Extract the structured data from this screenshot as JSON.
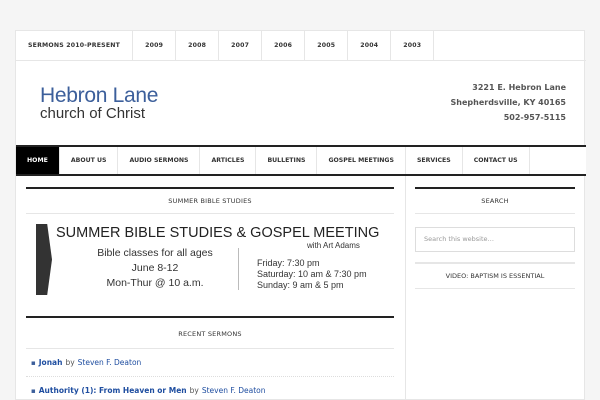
{
  "top_nav": [
    "SERMONS 2010-PRESENT",
    "2009",
    "2008",
    "2007",
    "2006",
    "2005",
    "2004",
    "2003"
  ],
  "logo": {
    "line1": "Hebron Lane",
    "line2": "church of Christ"
  },
  "address": {
    "street": "3221 E. Hebron Lane",
    "city": "Shepherdsville, KY 40165",
    "phone": "502-957-5115"
  },
  "main_nav": [
    "HOME",
    "ABOUT US",
    "AUDIO SERMONS",
    "ARTICLES",
    "BULLETINS",
    "GOSPEL MEETINGS",
    "SERVICES",
    "CONTACT US"
  ],
  "content": {
    "summer_title": "SUMMER BIBLE STUDIES",
    "banner": {
      "title": "SUMMER BIBLE STUDIES & GOSPEL MEETING",
      "subtitle": "with Art Adams",
      "left1": "Bible classes for all ages",
      "left2": "June 8-12",
      "left3": "Mon-Thur @ 10 a.m.",
      "right1": "Friday: 7:30 pm",
      "right2": "Saturday: 10 am & 7:30 pm",
      "right3": "Sunday: 9 am & 5 pm"
    },
    "recent_title": "RECENT SERMONS",
    "sermons": [
      {
        "title": "Jonah",
        "by": "by",
        "author": "Steven F. Deaton"
      },
      {
        "title": "Authority (1): From Heaven or Men",
        "by": "by",
        "author": "Steven F. Deaton"
      }
    ]
  },
  "sidebar": {
    "search_title": "SEARCH",
    "search_placeholder": "Search this website…",
    "video_title": "VIDEO: BAPTISM IS ESSENTIAL"
  }
}
